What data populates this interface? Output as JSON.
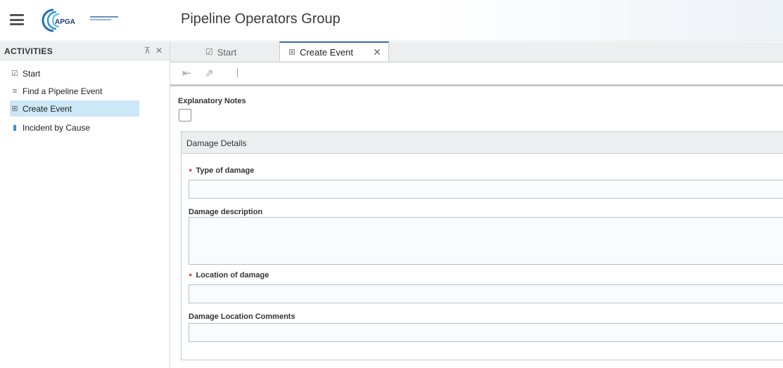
{
  "header": {
    "app_title": "Pipeline Operators Group",
    "logo_text": "APGA"
  },
  "sidebar": {
    "title": "ACTIVITIES",
    "items": [
      {
        "label": "Start",
        "icon": "checkbox-edit-icon"
      },
      {
        "label": "Find a Pipeline Event",
        "icon": "search-list-icon"
      },
      {
        "label": "Create Event",
        "icon": "create-record-icon",
        "active": true
      },
      {
        "label": "Incident by Cause",
        "icon": "chart-icon"
      }
    ]
  },
  "tabs": {
    "start_label": "Start",
    "create_event_label": "Create Event"
  },
  "form": {
    "explanatory_notes_label": "Explanatory Notes",
    "panel_title": "Damage Details",
    "fields": {
      "type_of_damage": "Type of damage",
      "damage_description": "Damage description",
      "location_of_damage": "Location of damage",
      "damage_location_comments": "Damage Location Comments"
    }
  },
  "colors": {
    "active_item_bg": "#cde8f6",
    "active_tab_accent": "#3b6fb6",
    "required_marker": "#e05252"
  }
}
